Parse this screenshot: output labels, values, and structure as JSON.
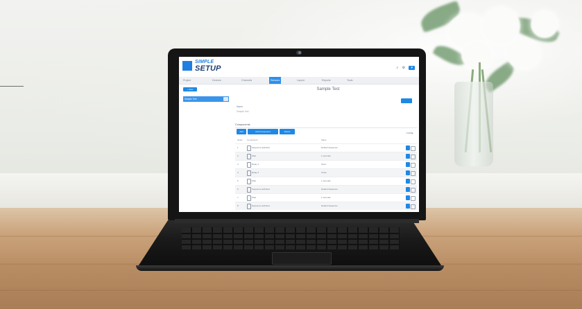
{
  "app": {
    "logo_top": "SIMPLE",
    "logo_bottom": "SETUP",
    "header_icons": [
      "search-icon",
      "settings-icon"
    ],
    "user_button": "▾"
  },
  "tabs": [
    {
      "label": "Project",
      "active": false
    },
    {
      "label": "Devices",
      "active": false
    },
    {
      "label": "Channels",
      "active": false
    },
    {
      "label": "Sensors",
      "active": true
    },
    {
      "label": "Layout",
      "active": false
    },
    {
      "label": "Reports",
      "active": false
    },
    {
      "label": "Tools",
      "active": false
    }
  ],
  "sidebar": {
    "new_button": "+ New",
    "items": [
      {
        "label": "Sample Test"
      }
    ]
  },
  "main": {
    "title": "Sample Test",
    "edit_button": "Edit",
    "name_label": "Name",
    "name_value": "Sample Test",
    "components_label": "Components",
    "toolbar": [
      "Add",
      "Add Component",
      "Delete"
    ],
    "load_label": "Load ▶",
    "columns": [
      "Order",
      "Component",
      "",
      "Value"
    ]
  },
  "components": [
    {
      "order": "1",
      "name": "Sequence definition",
      "value": "Default Sequence"
    },
    {
      "order": "2",
      "name": "Wait",
      "value": "1 seconds"
    },
    {
      "order": "3",
      "name": "Relay 1",
      "value": "Open"
    },
    {
      "order": "4",
      "name": "Relay 2",
      "value": "Close"
    },
    {
      "order": "5",
      "name": "Wait",
      "value": "1 seconds"
    },
    {
      "order": "6",
      "name": "Sequence definition",
      "value": "Default Sequence"
    },
    {
      "order": "7",
      "name": "Wait",
      "value": "1 seconds"
    },
    {
      "order": "8",
      "name": "Sequence definition",
      "value": "Default Sequence"
    }
  ],
  "colors": {
    "accent": "#1e88e5",
    "logo_dark": "#1c3f70",
    "laptop": "#151515"
  }
}
